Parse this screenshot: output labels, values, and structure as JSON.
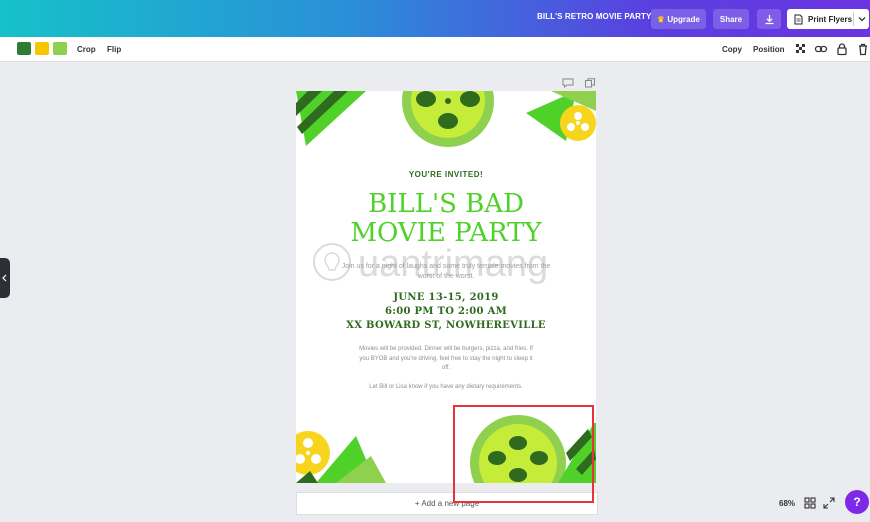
{
  "header": {
    "document_title": "BILL'S RETRO MOVIE PARTY",
    "upgrade_label": "Upgrade",
    "share_label": "Share",
    "print_label": "Print Flyers"
  },
  "toolbar": {
    "colors": [
      "#2f7d32",
      "#f7c600",
      "#8fd14f"
    ],
    "crop_label": "Crop",
    "flip_label": "Flip",
    "copy_label": "Copy",
    "position_label": "Position"
  },
  "flyer": {
    "invited": "YOU'RE INVITED!",
    "headline_line1": "BILL'S BAD",
    "headline_line2": "MOVIE PARTY",
    "subtext": "Join us for a night of laughs and some truly terrible movies from the worst of the worst.",
    "date": "JUNE 13-15, 2019",
    "time": "6:00 PM TO 2:00 AM",
    "address": "XX BOWARD ST, NOWHEREVILLE",
    "body1": "Movies will be provided. Dinner will be burgers, pizza, and fries. If you BYOB and you're driving, feel free to stay the night to sleep it off.",
    "body2": "Let Bill or Lisa know if you have any dietary requirements."
  },
  "add_page_label": "+ Add a new page",
  "watermark_text": "uantrimang",
  "footer": {
    "zoom": "68%",
    "help": "?"
  },
  "accent_colors": {
    "header_gradient_start": "#16c1c9",
    "header_gradient_end": "#6b35e3",
    "flyer_green": "#4fd12a",
    "flyer_dark_green": "#2e6b1e",
    "reel_yellow": "#f7d51d",
    "highlight_red": "#e8313a"
  }
}
